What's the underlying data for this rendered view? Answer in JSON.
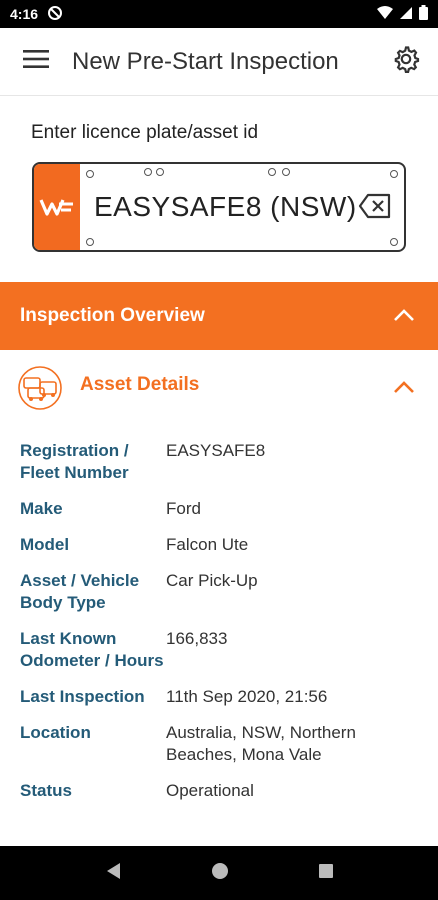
{
  "status_bar": {
    "time": "4:16"
  },
  "app_bar": {
    "title": "New Pre-Start Inspection"
  },
  "plate": {
    "label": "Enter licence plate/asset id",
    "value": "EASYSAFE8 (NSW)"
  },
  "overview": {
    "title": "Inspection Overview"
  },
  "asset_details": {
    "title": "Asset Details",
    "rows": [
      {
        "label": "Registration / Fleet Number",
        "value": "EASYSAFE8"
      },
      {
        "label": "Make",
        "value": "Ford"
      },
      {
        "label": "Model",
        "value": "Falcon Ute"
      },
      {
        "label": "Asset / Vehicle Body Type",
        "value": "Car Pick-Up"
      },
      {
        "label": "Last Known Odometer / Hours",
        "value": "166,833"
      },
      {
        "label": "Last Inspection",
        "value": "11th Sep 2020, 21:56"
      },
      {
        "label": "Location",
        "value": "Australia, NSW, Northern Beaches, Mona Vale"
      },
      {
        "label": "Status",
        "value": "Operational"
      }
    ]
  },
  "colors": {
    "accent": "#f37021",
    "label": "#245b78"
  },
  "icons": [
    "menu-icon",
    "gear-icon",
    "clear-icon",
    "chevron-up-icon",
    "asset-vehicles-icon",
    "back-icon",
    "home-icon",
    "recents-icon"
  ]
}
